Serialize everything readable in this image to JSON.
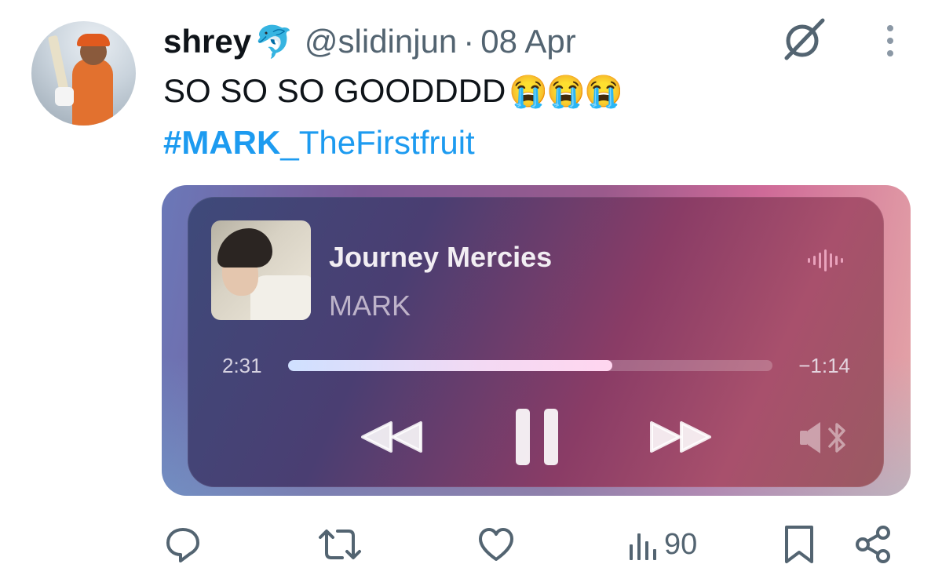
{
  "tweet": {
    "author_name": "shrey",
    "author_emoji": "🐬",
    "handle": "@slidinjun",
    "separator": "·",
    "date": "08 Apr",
    "text": "SO SO SO GOODDDD",
    "text_emojis": "😭😭😭",
    "hashtag_bold": "#MARK",
    "hashtag_rest": "_TheFirstfruit"
  },
  "player": {
    "song_title": "Journey Mercies",
    "artist": "MARK",
    "elapsed": "2:31",
    "remaining": "−1:14",
    "progress_fraction": 0.67
  },
  "actions": {
    "views": "90",
    "icons": [
      "reply-icon",
      "retweet-icon",
      "like-icon",
      "views-icon",
      "bookmark-icon",
      "share-icon"
    ]
  },
  "colors": {
    "link": "#1d9bf0",
    "secondary_text": "#536471",
    "icon": "#536471"
  }
}
